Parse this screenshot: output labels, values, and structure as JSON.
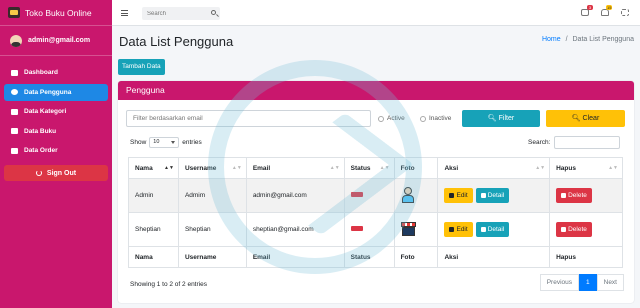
{
  "brand": {
    "title": "Toko Buku Online"
  },
  "user": {
    "email": "admin@gmail.com"
  },
  "sidebar": {
    "items": [
      {
        "label": "Dashboard",
        "icon": "dashboard-icon"
      },
      {
        "label": "Data Pengguna",
        "icon": "user-circle-icon",
        "active": true
      },
      {
        "label": "Data Kategori",
        "icon": "folder-icon"
      },
      {
        "label": "Data Buku",
        "icon": "book-icon"
      },
      {
        "label": "Data Order",
        "icon": "cart-icon"
      }
    ],
    "signout": "Sign Out"
  },
  "topbar": {
    "search_placeholder": "Search",
    "badge_messages": "3",
    "badge_notifications": "15"
  },
  "header": {
    "title": "Data List Pengguna",
    "breadcrumb_home": "Home",
    "breadcrumb_sep": "/",
    "breadcrumb_current": "Data List Pengguna"
  },
  "actions": {
    "add": "Tambah Data"
  },
  "card": {
    "title": "Pengguna",
    "filter_placeholder": "Filter berdasarkan email",
    "radio_active": "Active",
    "radio_inactive": "Inactive",
    "filter_btn": "Filter",
    "clear_btn": "Clear",
    "show": "Show",
    "length_value": "10",
    "entries": "entries",
    "search_label": "Search:"
  },
  "table": {
    "columns": [
      "Nama",
      "Username",
      "Email",
      "Status",
      "Foto",
      "Aksi",
      "Hapus"
    ],
    "rows": [
      {
        "nama": "Admin",
        "username": "Admim",
        "email": "admin@gmail.com",
        "photo": "user-photo"
      },
      {
        "nama": "Sheptian",
        "username": "Sheptian",
        "email": "sheptian@gmail.com",
        "photo": "shop-photo"
      }
    ],
    "edit": "Edit",
    "detail": "Detail",
    "delete": "Delete"
  },
  "footer": {
    "info": "Showing 1 to 2 of 2 entries",
    "previous": "Previous",
    "page": "1",
    "next": "Next"
  },
  "colors": {
    "sidebar": "#c9176d",
    "active": "#1e88e5",
    "info": "#17a2b8",
    "warning": "#ffc107",
    "danger": "#dc3545"
  }
}
